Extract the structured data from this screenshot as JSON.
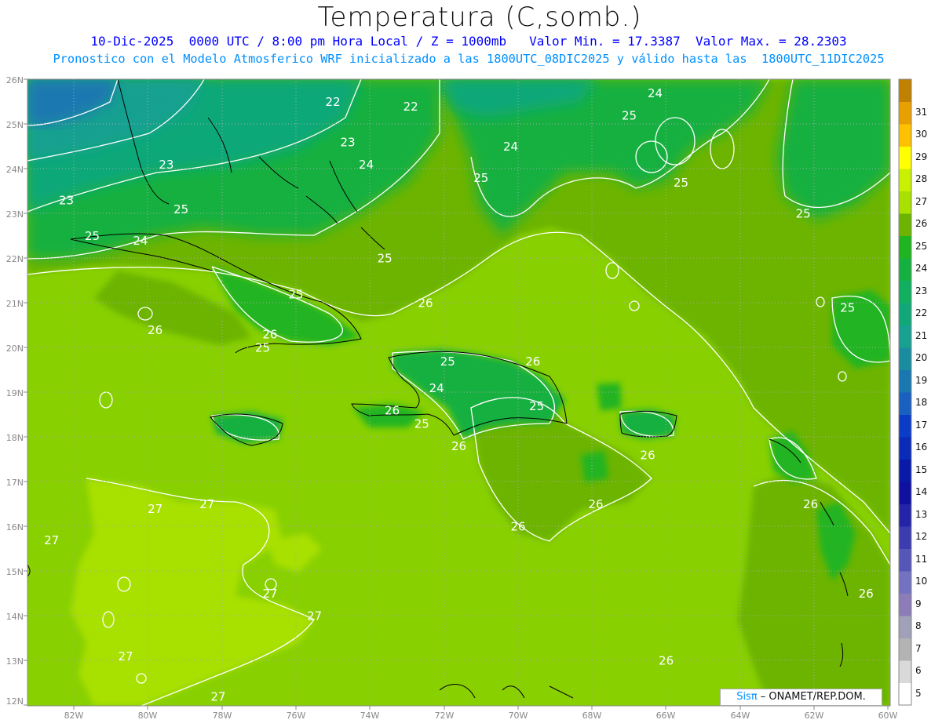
{
  "header": {
    "title": "Temperatura (C,somb.)",
    "subtitle_line1": "10-Dic-2025  0000 UTC / 8:00 pm Hora Local / Z = 1000mb   Valor Min. = 17.3387  Valor Max. = 28.2303",
    "subtitle_line2": "Pronostico con el Modelo Atmosferico WRF inicializado a las 1800UTC_08DIC2025 y válido hasta las  1800UTC_11DIC2025"
  },
  "axes": {
    "lat_labels": [
      "26N",
      "25N",
      "24N",
      "23N",
      "22N",
      "21N",
      "20N",
      "19N",
      "18N",
      "17N",
      "16N",
      "15N",
      "14N",
      "13N",
      "12N"
    ],
    "lon_labels": [
      "82W",
      "80W",
      "78W",
      "76W",
      "74W",
      "72W",
      "70W",
      "68W",
      "66W",
      "64W",
      "62W",
      "60W"
    ]
  },
  "colorbar": {
    "labels": [
      "5",
      "6",
      "7",
      "8",
      "9",
      "10",
      "11",
      "12",
      "13",
      "14",
      "15",
      "16",
      "17",
      "18",
      "19",
      "20",
      "21",
      "22",
      "23",
      "24",
      "25",
      "26",
      "27",
      "28",
      "29",
      "30",
      "31"
    ],
    "colors": [
      "#ffffff",
      "#d9d9d9",
      "#b3b3b3",
      "#a0a0b8",
      "#8c7cb8",
      "#7272c0",
      "#5656b8",
      "#3c3cb0",
      "#2424a8",
      "#1010a0",
      "#0a1aa8",
      "#0a2ab8",
      "#0a3cc8",
      "#1a60c0",
      "#1a78b0",
      "#1a8ca0",
      "#18a090",
      "#10a878",
      "#10b060",
      "#14b040",
      "#20b420",
      "#6cb400",
      "#a8e000",
      "#c8f000",
      "#ffff00",
      "#ffc000",
      "#e8a000",
      "#c08000"
    ]
  },
  "contour_labels": [
    {
      "text": "22",
      "lon": -75.0,
      "lat": 25.4
    },
    {
      "text": "22",
      "lon": -72.9,
      "lat": 25.3
    },
    {
      "text": "23",
      "lon": -74.6,
      "lat": 24.5
    },
    {
      "text": "23",
      "lon": -79.5,
      "lat": 24.0
    },
    {
      "text": "24",
      "lon": -74.1,
      "lat": 24.0
    },
    {
      "text": "24",
      "lon": -70.2,
      "lat": 24.4
    },
    {
      "text": "24",
      "lon": -66.3,
      "lat": 25.6
    },
    {
      "text": "25",
      "lon": -67.0,
      "lat": 25.1
    },
    {
      "text": "25",
      "lon": -71.0,
      "lat": 23.7
    },
    {
      "text": "25",
      "lon": -65.6,
      "lat": 23.6
    },
    {
      "text": "23",
      "lon": -82.2,
      "lat": 23.2
    },
    {
      "text": "25",
      "lon": -79.1,
      "lat": 23.0
    },
    {
      "text": "25",
      "lon": -62.3,
      "lat": 22.9
    },
    {
      "text": "25",
      "lon": -81.5,
      "lat": 22.4
    },
    {
      "text": "24",
      "lon": -80.2,
      "lat": 22.3
    },
    {
      "text": "25",
      "lon": -73.6,
      "lat": 21.9
    },
    {
      "text": "25",
      "lon": -76.0,
      "lat": 21.1
    },
    {
      "text": "26",
      "lon": -72.5,
      "lat": 20.9
    },
    {
      "text": "25",
      "lon": -61.1,
      "lat": 20.8
    },
    {
      "text": "26",
      "lon": -79.8,
      "lat": 20.3
    },
    {
      "text": "26",
      "lon": -76.7,
      "lat": 20.2
    },
    {
      "text": "25",
      "lon": -76.9,
      "lat": 19.9
    },
    {
      "text": "25",
      "lon": -71.9,
      "lat": 19.6
    },
    {
      "text": "26",
      "lon": -69.6,
      "lat": 19.6
    },
    {
      "text": "24",
      "lon": -72.2,
      "lat": 19.0
    },
    {
      "text": "25",
      "lon": -69.5,
      "lat": 18.6
    },
    {
      "text": "26",
      "lon": -73.4,
      "lat": 18.5
    },
    {
      "text": "25",
      "lon": -72.6,
      "lat": 18.2
    },
    {
      "text": "26",
      "lon": -71.6,
      "lat": 17.7
    },
    {
      "text": "26",
      "lon": -66.5,
      "lat": 17.5
    },
    {
      "text": "26",
      "lon": -67.9,
      "lat": 16.4
    },
    {
      "text": "26",
      "lon": -62.1,
      "lat": 16.4
    },
    {
      "text": "26",
      "lon": -70.0,
      "lat": 15.9
    },
    {
      "text": "27",
      "lon": -78.4,
      "lat": 16.4
    },
    {
      "text": "27",
      "lon": -79.8,
      "lat": 16.3
    },
    {
      "text": "27",
      "lon": -82.6,
      "lat": 15.6
    },
    {
      "text": "27",
      "lon": -76.7,
      "lat": 14.4
    },
    {
      "text": "27",
      "lon": -75.5,
      "lat": 13.9
    },
    {
      "text": "26",
      "lon": -60.6,
      "lat": 14.4
    },
    {
      "text": "27",
      "lon": -80.6,
      "lat": 13.0
    },
    {
      "text": "26",
      "lon": -66.0,
      "lat": 12.9
    },
    {
      "text": "27",
      "lon": -78.1,
      "lat": 12.1
    }
  ],
  "credit": {
    "sis": "Sisπ",
    "text": " – ONAMET/REP.DOM."
  }
}
